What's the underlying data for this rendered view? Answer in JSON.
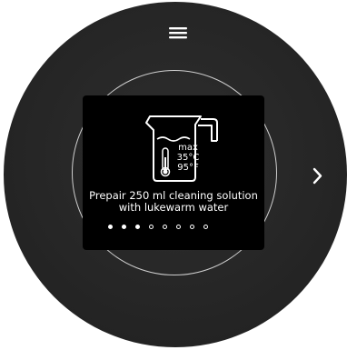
{
  "header": {
    "menu_icon": "hamburger-menu-icon"
  },
  "navigation": {
    "next_icon": "chevron-right-icon"
  },
  "step": {
    "icon": "measuring-jug-with-thermometer-icon",
    "jug_labels": {
      "max": "max",
      "temp_c": "35°C",
      "temp_f": "95°F"
    },
    "instruction_line1": "Prepair 250 ml cleaning solution",
    "instruction_line2": "with lukewarm water"
  },
  "pagination": {
    "total": 8,
    "current": 3
  },
  "colors": {
    "disc": "#262626",
    "screen": "#000000",
    "ring": "#cfcfcf",
    "text": "#ffffff"
  }
}
